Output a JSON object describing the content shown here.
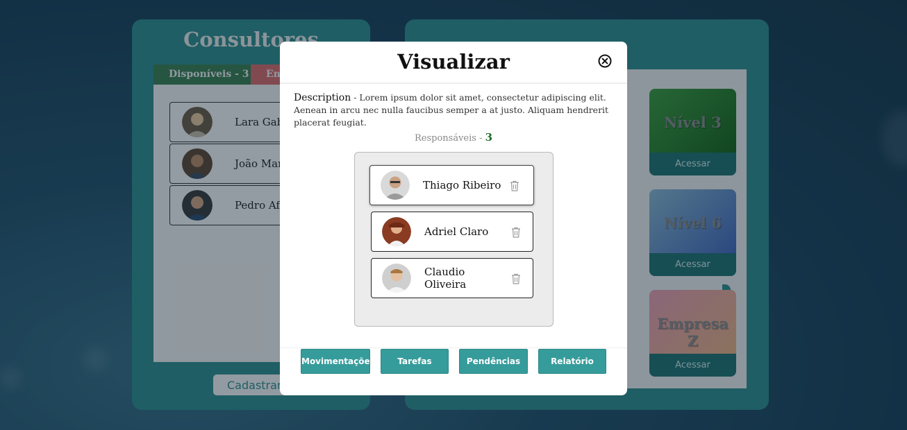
{
  "background": {
    "left_panel": {
      "title": "Consultores",
      "tabs": [
        "Disponíveis - 3",
        "En"
      ],
      "consultants": [
        "Lara Gabr",
        "João Marc",
        "Pedro Afo"
      ],
      "register_label": "Cadastrar"
    },
    "right_panel": {
      "cards": [
        {
          "title": "Nível 3",
          "action": "Acessar"
        },
        {
          "title": "Nível 6",
          "action": "Acessar"
        },
        {
          "title": "Empresa Z",
          "action": "Acessar"
        }
      ]
    }
  },
  "modal": {
    "title": "Visualizar",
    "description_label": "Description",
    "description_sep": " - ",
    "description_text": "Lorem ipsum dolor sit amet, consectetur adipiscing elit. Aenean in arcu nec nulla faucibus semper a at justo. Aliquam hendrerit placerat feugiat.",
    "responsaveis_label": "Responsáveis - ",
    "responsaveis_count": "3",
    "people": [
      {
        "name_line1": "Thiago Ribeiro",
        "name_line2": ""
      },
      {
        "name_line1": "Adriel Claro",
        "name_line2": ""
      },
      {
        "name_line1": "Claudio",
        "name_line2": "Oliveira"
      }
    ],
    "actions": [
      "Movimentações",
      "Tarefas",
      "Pendências",
      "Relatório"
    ]
  },
  "colors": {
    "teal": "#2f8c8c",
    "button_teal": "#369c9b",
    "access_bar": "#1f7170",
    "count_green": "#1f6d2a"
  },
  "icons": {
    "close": "circle-x-icon",
    "delete": "trash-icon"
  }
}
